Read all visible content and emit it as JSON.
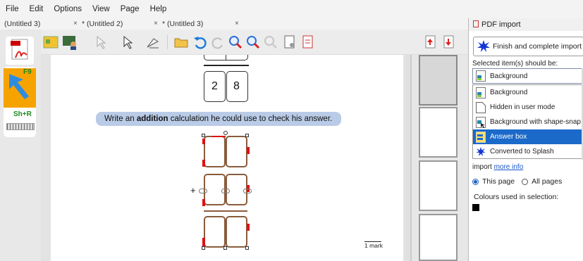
{
  "menu": [
    "File",
    "Edit",
    "Options",
    "View",
    "Page",
    "Help"
  ],
  "tabs": [
    {
      "label": "(Untitled 3)",
      "close": "×"
    },
    {
      "label": "* (Untitled 2)",
      "close": "×"
    },
    {
      "label": "* (Untitled 3)",
      "close": "×"
    }
  ],
  "left_tools": {
    "f9": "F9",
    "shr": "Sh+R"
  },
  "worksheet": {
    "digit1": "2",
    "digit2": "8",
    "instruction_prefix": "Write an ",
    "instruction_bold": "addition",
    "instruction_suffix": " calculation he could use to check his answer.",
    "mark": "1 mark",
    "plus": "+"
  },
  "panel": {
    "title": "PDF import",
    "finish_button": "Finish and complete import",
    "selected_label": "Selected item(s) should be:",
    "selected_value": "Background",
    "options": [
      "Background",
      "Hidden in user mode",
      "Background with shape-snap",
      "Answer box",
      "Converted to Splash"
    ],
    "selected_option_index": 3,
    "import_text": "import",
    "more_info": "more info",
    "radio_this_page": "This page",
    "radio_all_pages": "All pages",
    "colours_label": "Colours used in selection:"
  },
  "colors": {
    "accent": "#1b6ac9",
    "instruction_bg": "#b9cbe6",
    "answer_border": "#8a5c3c",
    "handle": "#dd1111"
  }
}
